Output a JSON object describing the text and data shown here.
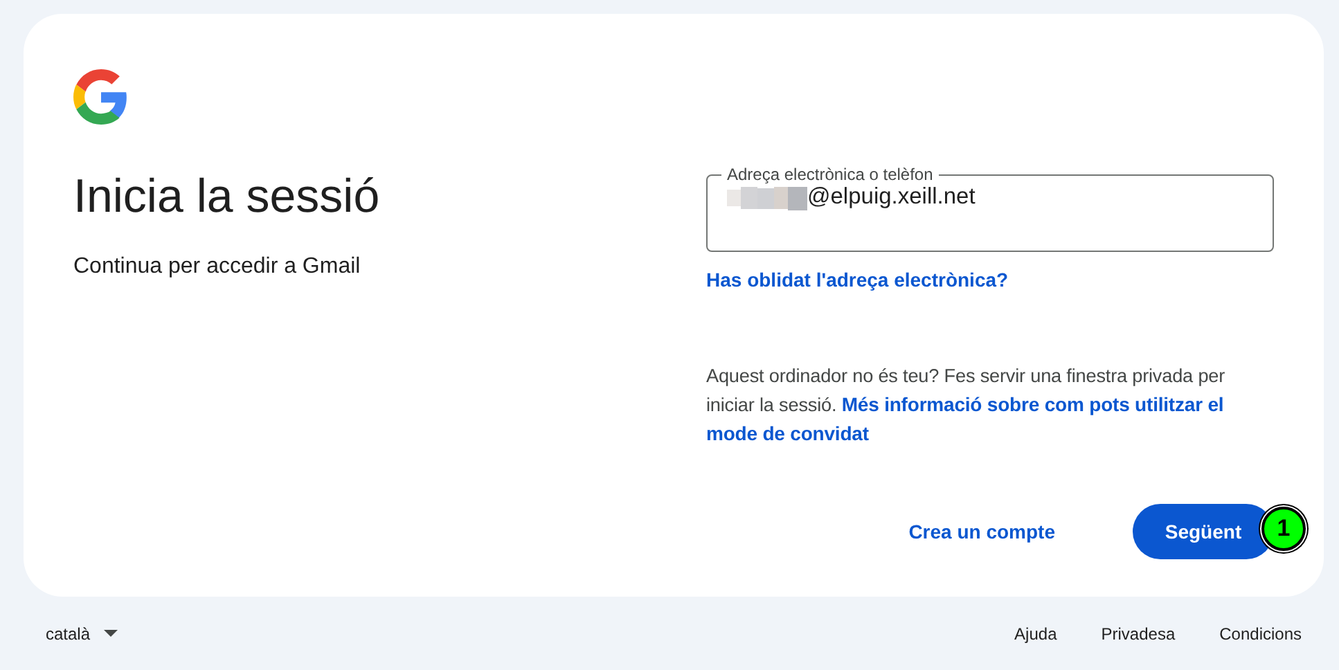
{
  "card": {
    "title": "Inicia la sessió",
    "subtitle": "Continua per accedir a Gmail",
    "field": {
      "label": "Adreça electrònica o telèfon",
      "value": "@elpuig.xeill.net",
      "redacted": true
    },
    "forgot_link": "Has oblidat l'adreça electrònica?",
    "notice": {
      "text": "Aquest ordinador no és teu? Fes servir una finestra privada per iniciar la sessió.",
      "link": "Més informació sobre com pots utilitzar el mode de convidat"
    },
    "create_account": "Crea un compte",
    "next_button": "Següent",
    "marker": "1"
  },
  "footer": {
    "language": "català",
    "links": [
      "Ajuda",
      "Privadesa",
      "Condicions"
    ]
  }
}
